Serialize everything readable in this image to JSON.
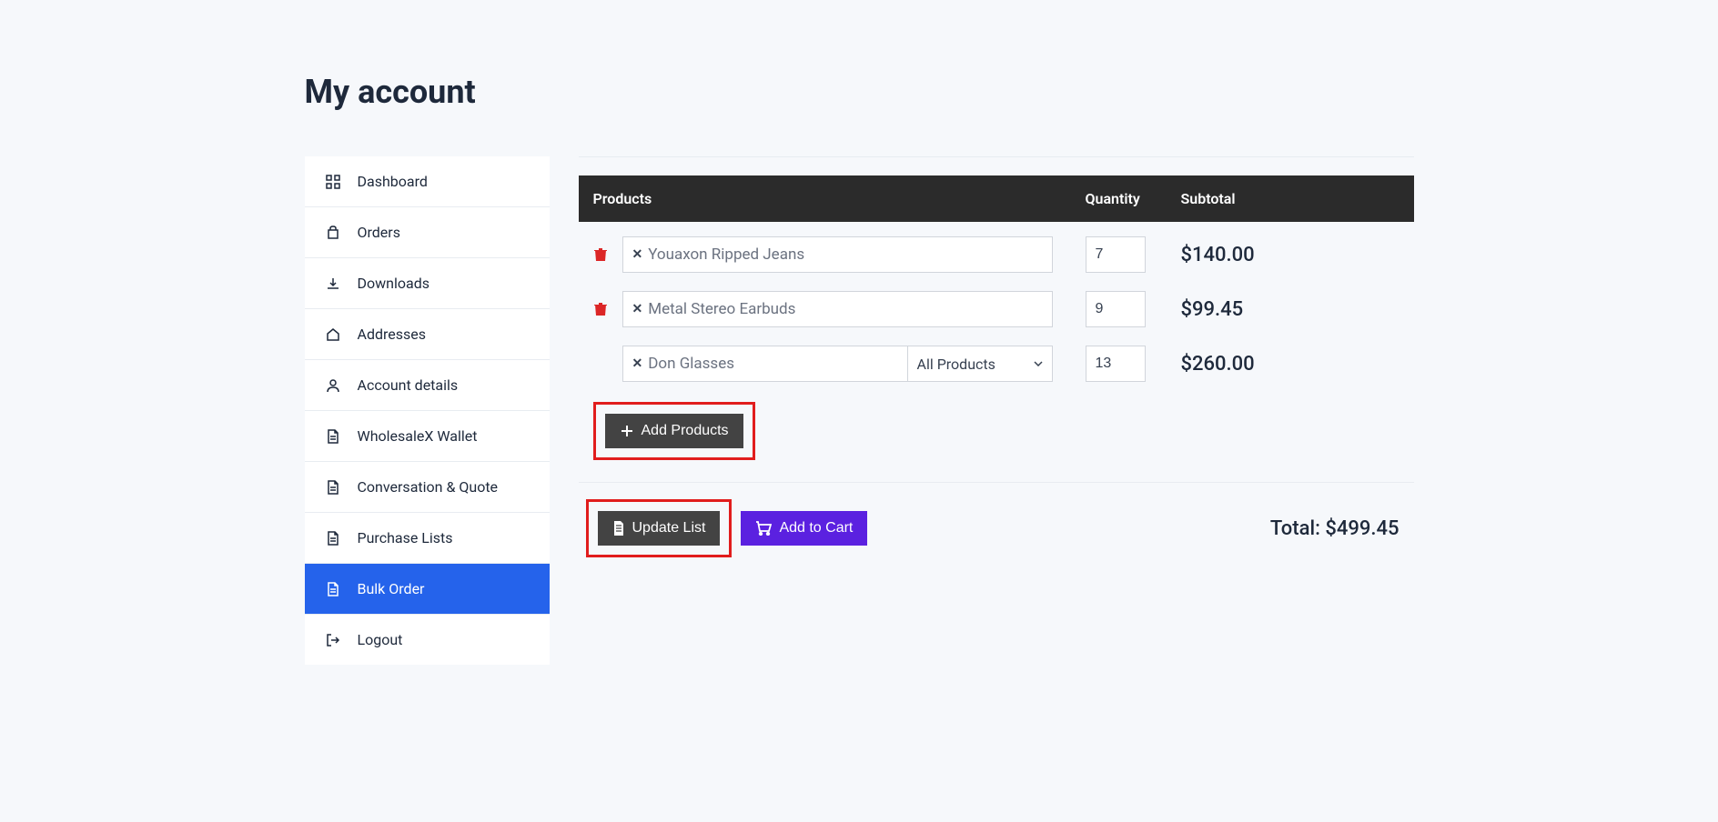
{
  "pageTitle": "My account",
  "sidebar": {
    "items": [
      {
        "label": "Dashboard",
        "icon": "dashboard"
      },
      {
        "label": "Orders",
        "icon": "orders"
      },
      {
        "label": "Downloads",
        "icon": "downloads"
      },
      {
        "label": "Addresses",
        "icon": "addresses"
      },
      {
        "label": "Account details",
        "icon": "account"
      },
      {
        "label": "WholesaleX Wallet",
        "icon": "document"
      },
      {
        "label": "Conversation & Quote",
        "icon": "document"
      },
      {
        "label": "Purchase Lists",
        "icon": "document"
      },
      {
        "label": "Bulk Order",
        "icon": "document",
        "active": true
      },
      {
        "label": "Logout",
        "icon": "logout"
      }
    ]
  },
  "table": {
    "headers": {
      "products": "Products",
      "quantity": "Quantity",
      "subtotal": "Subtotal"
    },
    "rows": [
      {
        "product": "Youaxon Ripped Jeans",
        "quantity": "7",
        "subtotal": "$140.00",
        "hasDelete": true,
        "hasDropdown": false
      },
      {
        "product": "Metal Stereo Earbuds",
        "quantity": "9",
        "subtotal": "$99.45",
        "hasDelete": true,
        "hasDropdown": false
      },
      {
        "product": "Don Glasses",
        "quantity": "13",
        "subtotal": "$260.00",
        "hasDelete": false,
        "hasDropdown": true,
        "dropdownLabel": "All Products"
      }
    ]
  },
  "buttons": {
    "addProducts": "Add Products",
    "updateList": "Update List",
    "addToCart": "Add to Cart"
  },
  "total": {
    "label": "Total: ",
    "value": "$499.45"
  }
}
